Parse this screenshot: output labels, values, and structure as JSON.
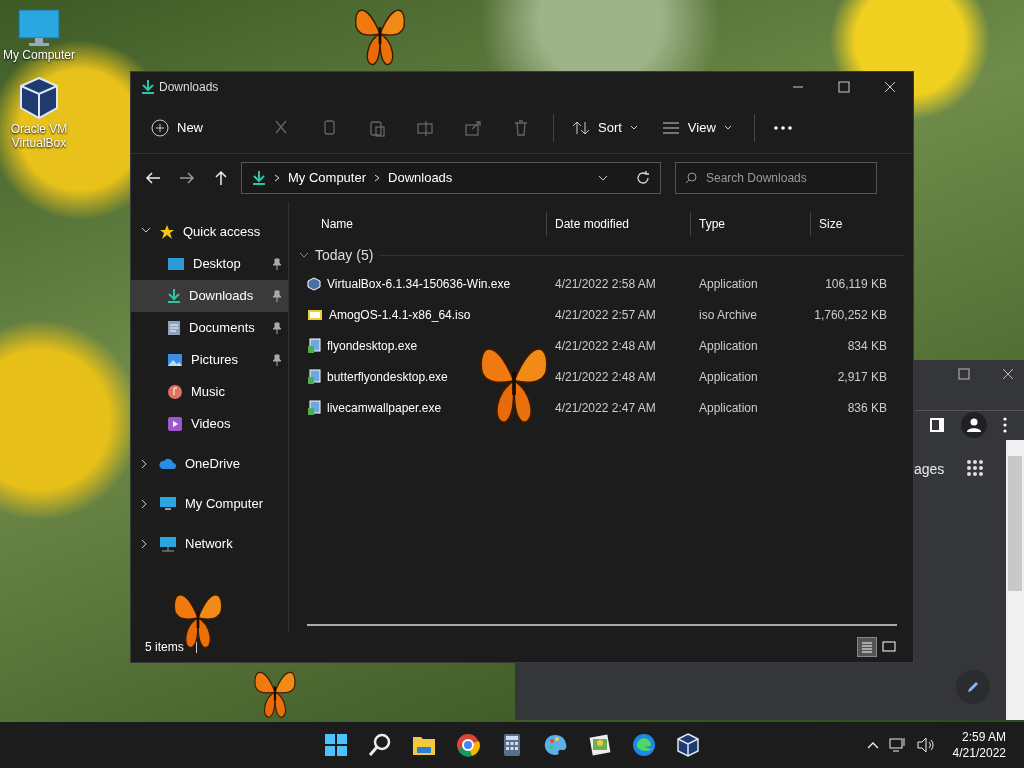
{
  "desktop_icons": [
    {
      "label": "My Computer"
    },
    {
      "label": "Oracle VM VirtualBox"
    }
  ],
  "explorer": {
    "title": "Downloads",
    "toolbar": {
      "new": "New",
      "sort": "Sort",
      "view": "View"
    },
    "address": [
      "My Computer",
      "Downloads"
    ],
    "search": {
      "placeholder": "Search Downloads"
    },
    "nav": [
      {
        "label": "Quick access",
        "expanded": true,
        "selected": false,
        "children": [
          {
            "label": "Desktop",
            "pinned": true,
            "selected": false
          },
          {
            "label": "Downloads",
            "pinned": true,
            "selected": true
          },
          {
            "label": "Documents",
            "pinned": true,
            "selected": false
          },
          {
            "label": "Pictures",
            "pinned": true,
            "selected": false
          },
          {
            "label": "Music",
            "pinned": false,
            "selected": false
          },
          {
            "label": "Videos",
            "pinned": false,
            "selected": false
          }
        ]
      },
      {
        "label": "OneDrive",
        "expanded": false,
        "selected": false
      },
      {
        "label": "My Computer",
        "expanded": false,
        "selected": false
      },
      {
        "label": "Network",
        "expanded": false,
        "selected": false
      }
    ],
    "columns": [
      "Name",
      "Date modified",
      "Type",
      "Size"
    ],
    "group": "Today (5)",
    "rows": [
      {
        "name": "VirtualBox-6.1.34-150636-Win.exe",
        "date": "4/21/2022 2:58 AM",
        "type": "Application",
        "size": "106,119 KB",
        "kind": "installer"
      },
      {
        "name": "AmogOS-1.4.1-x86_64.iso",
        "date": "4/21/2022 2:57 AM",
        "type": "iso Archive",
        "size": "1,760,252 KB",
        "kind": "iso"
      },
      {
        "name": "flyondesktop.exe",
        "date": "4/21/2022 2:48 AM",
        "type": "Application",
        "size": "834 KB",
        "kind": "app"
      },
      {
        "name": "butterflyondesktop.exe",
        "date": "4/21/2022 2:48 AM",
        "type": "Application",
        "size": "2,917 KB",
        "kind": "app"
      },
      {
        "name": "livecamwallpaper.exe",
        "date": "4/21/2022 2:47 AM",
        "type": "Application",
        "size": "836 KB",
        "kind": "app"
      }
    ],
    "status": "5 items",
    "views": [
      {
        "kind": "details",
        "selected": true
      },
      {
        "kind": "tiles",
        "selected": false
      }
    ]
  },
  "browser": {
    "partial_link": "ages"
  },
  "taskbar": {
    "time": "2:59 AM",
    "date": "4/21/2022"
  }
}
